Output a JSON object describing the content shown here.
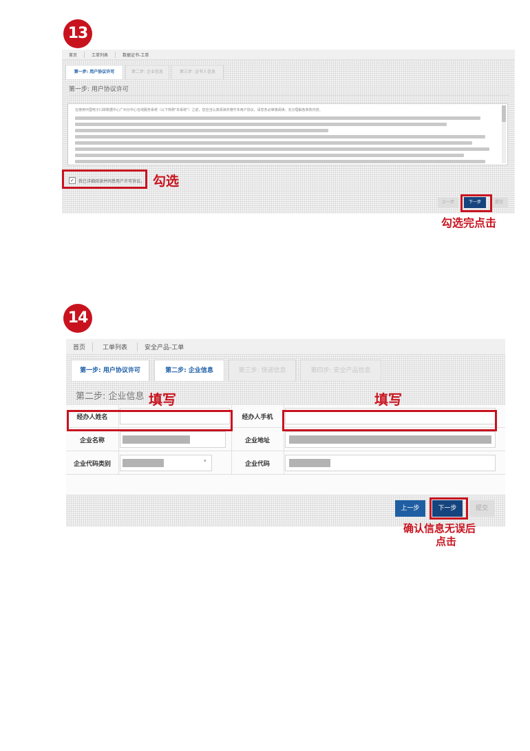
{
  "step13": {
    "number": "13",
    "breadcrumbs": [
      "首页",
      "工单列表",
      "数据证书-工单"
    ],
    "tabs": [
      "第一步: 用户协议许可",
      "第二步: 企业信息",
      "第三步: 证书人信息"
    ],
    "section_title": "第一步: 用户协议许可",
    "agreement_text": "在使用中国电子口岸数据中心广州分中心在线服务系统（以下简称\"本系统\"）之前，您应当认真阅读并遵守本用户协议，请您务必审慎阅读、充分理解各条款内容。",
    "checkbox_label": "我已详细阅读并同意用户许可协议。",
    "checkbox_checked": true,
    "annotation_check": "勾选",
    "buttons": {
      "prev": "上一步",
      "next": "下一步",
      "submit": "提交"
    },
    "annotation_click": "勾选完点击"
  },
  "step14": {
    "number": "14",
    "breadcrumbs": [
      "首页",
      "工单列表",
      "安全产品-工单"
    ],
    "tabs": [
      "第一步: 用户协议许可",
      "第二步: 企业信息",
      "第三步: 快递信息",
      "第四步: 安全产品信息"
    ],
    "section_title": "第二步: 企业信息",
    "annotation_fill_left": "填写",
    "annotation_fill_right": "填写",
    "fields": {
      "agent_name": "经办人姓名",
      "agent_phone": "经办人手机",
      "company_name": "企业名称",
      "company_address": "企业地址",
      "company_code_type": "企业代码类别",
      "company_code": "企业代码"
    },
    "buttons": {
      "prev": "上一步",
      "next": "下一步",
      "submit": "提交"
    },
    "annotation_confirm_line1": "确认信息无误后",
    "annotation_confirm_line2": "点击"
  }
}
